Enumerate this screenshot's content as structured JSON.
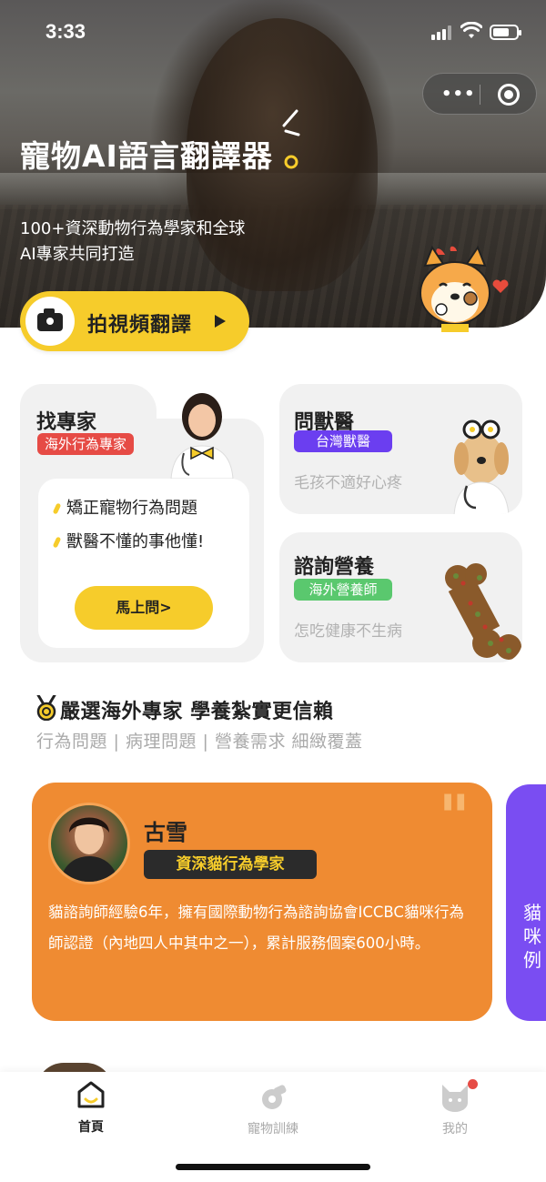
{
  "status": {
    "time": "3:33"
  },
  "hero": {
    "title": "寵物AI語言翻譯器",
    "subtitle_line1": "100+資深動物行為學家和全球",
    "subtitle_line2": "AI專家共同打造",
    "camera_button": "拍視頻翻譯"
  },
  "find_expert": {
    "title": "找專家",
    "tag": "海外行為專家",
    "bullet1": "矯正寵物行為問題",
    "bullet2": "獸醫不懂的事他懂!",
    "ask_button": "馬上問>"
  },
  "ask_vet": {
    "title": "問獸醫",
    "tag": "台灣獸醫",
    "desc": "毛孩不適好心疼"
  },
  "nutrition": {
    "title": "諮詢營養",
    "tag": "海外營養師",
    "desc": "怎吃健康不生病"
  },
  "section": {
    "title": "嚴選海外專家  學養紮實更信賴",
    "subtitle": "行為問題 | 病理問題 | 營養需求 細緻覆蓋"
  },
  "expert_card": {
    "name": "古雪",
    "tag": "資深貓行為學家",
    "description": "貓諮詢師經驗6年，擁有國際動物行為諮詢協會ICCBC貓咪行為師認證（內地四人中其中之一），累計服務個案600小時。"
  },
  "next_card": {
    "text": "貓咪例"
  },
  "tabbar": {
    "home": "首頁",
    "training": "寵物訓練",
    "mine": "我的"
  },
  "colors": {
    "accent_yellow": "#f6cc2b",
    "red_tag": "#e64b45",
    "purple_tag": "#6b3ef0",
    "green_tag": "#5ac86e",
    "orange_card": "#ef8b32",
    "purple_card": "#7a4df2"
  },
  "icons": [
    "camera-icon",
    "play-icon",
    "more-dots-icon",
    "target-icon",
    "medal-icon",
    "quote-icon",
    "home-icon",
    "whistle-icon",
    "cat-face-icon"
  ]
}
